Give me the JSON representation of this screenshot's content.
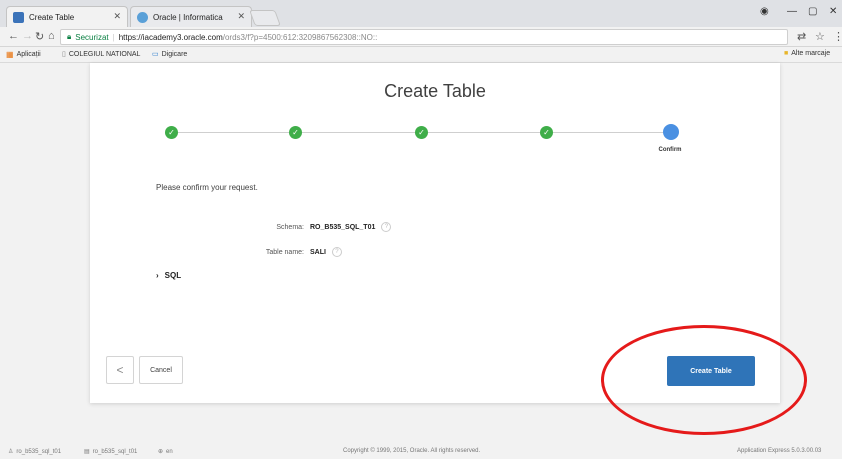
{
  "browser": {
    "tabs": [
      {
        "title": "Create Table",
        "favicon_color": "#3b73b9"
      },
      {
        "title": "Oracle | Informatica",
        "favicon_color": "#5aa0d8"
      }
    ],
    "omnibox": {
      "security_label": "Securizat",
      "url_host": "https://iacademy3.oracle.com",
      "url_path": "/ords3/f?p=4500:612:3209867562308::NO::"
    },
    "bookmarks": [
      {
        "label": "Aplicații",
        "icon": "apps-grid-icon"
      },
      {
        "label": "COLEGIUL NATIONAL",
        "icon": "page-icon"
      },
      {
        "label": "Digicare",
        "icon": "digicare-icon"
      }
    ],
    "other_bookmarks": "Alte marcaje"
  },
  "dialog": {
    "title": "Create Table",
    "wizard": {
      "current_step_label": "Confirm",
      "completed_steps": 4
    },
    "confirm_message": "Please confirm your request.",
    "fields": [
      {
        "label": "Schema:",
        "value": "RO_B535_SQL_T01"
      },
      {
        "label": "Table name:",
        "value": "SALI"
      }
    ],
    "sql_toggle_label": "SQL",
    "buttons": {
      "prev": "<",
      "cancel": "Cancel",
      "create": "Create Table"
    }
  },
  "footer": {
    "user": "ro_b535_sql_t01",
    "schema": "ro_b535_sql_t01",
    "language": "en",
    "copyright": "Copyright © 1999, 2015, Oracle. All rights reserved.",
    "version": "Application Express 5.0.3.00.03"
  },
  "colors": {
    "accent": "#2f74b8",
    "complete": "#3fae49",
    "current": "#4a90e2",
    "annotation": "#e51a1a"
  }
}
